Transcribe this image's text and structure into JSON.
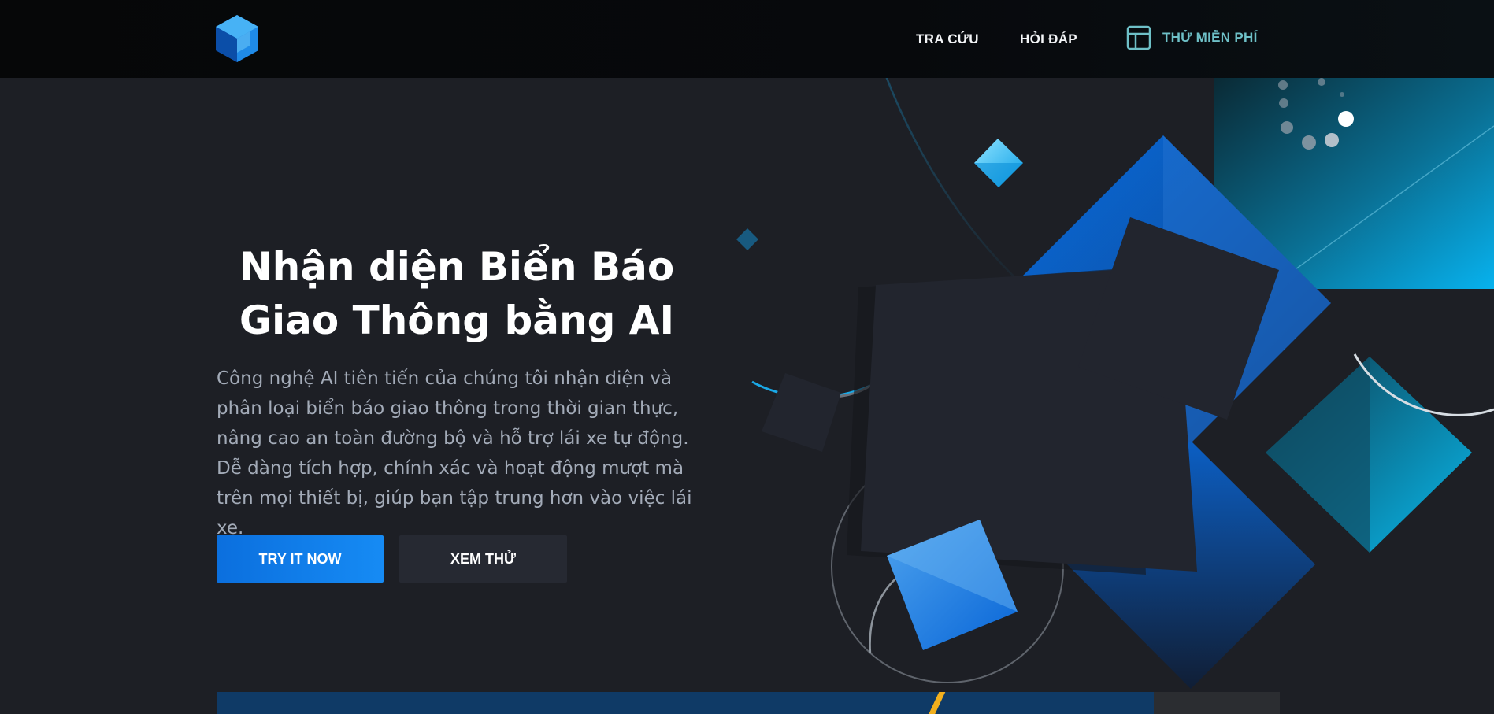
{
  "nav": {
    "tra_cuu": "TRA CỨU",
    "hoi_dap": "HỎI ĐÁP",
    "thu_mien_phi": "THỬ MIỄN PHÍ"
  },
  "hero": {
    "title_line1": "Nhận diện Biển Báo",
    "title_line2": "Giao Thông bằng AI",
    "description": "Công nghệ AI tiên tiến của chúng tôi nhận diện và phân loại biển báo giao thông trong thời gian thực, nâng cao an toàn đường bộ và hỗ trợ lái xe tự động. Dễ dàng tích hợp, chính xác và hoạt động mượt mà trên mọi thiết bị, giúp bạn tập trung hơn vào việc lái xe.",
    "primary_button": "TRY IT NOW",
    "secondary_button": "XEM THỬ"
  },
  "colors": {
    "background": "#1d1f25",
    "header": "#060708",
    "primary_button": "#0b6fde",
    "secondary_button": "#262932",
    "accent_teal": "#6ec0c7",
    "accent_blue": "#0a6cdc",
    "accent_cyan": "#09b8ee"
  },
  "icons": {
    "logo": "cube-logo-icon",
    "cta": "layout-icon"
  }
}
